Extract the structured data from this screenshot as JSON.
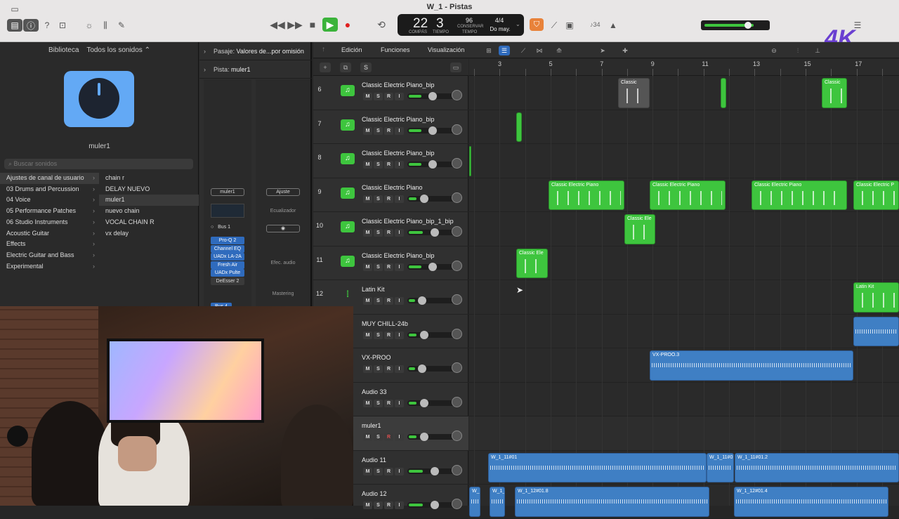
{
  "window": {
    "title": "W_1 - Pistas"
  },
  "lcd": {
    "bar": "22",
    "beat": "3",
    "bar_label": "COMPÁS",
    "beat_label": "TIEMPO",
    "tempo": "96",
    "tempo_label": "CONSERVAR",
    "tempo_sub": "TEMPO",
    "signature": "4/4",
    "key": "Do may."
  },
  "toolbar": {
    "count_in": "♪34"
  },
  "library": {
    "title": "Biblioteca",
    "filter": "Todos los sonidos ⌃",
    "patch_name": "muler1",
    "search_placeholder": "Buscar sonidos",
    "categories": [
      "Ajustes de canal de usuario",
      "03 Drums and Percussion",
      "04 Voice",
      "05 Performance Patches",
      "06 Studio Instruments",
      "Acoustic Guitar",
      "Effects",
      "Electric Guitar and Bass",
      "Experimental"
    ],
    "items": [
      "chain r",
      "DELAY NUEVO",
      "muler1",
      "nuevo chain",
      "VOCAL CHAIN R",
      "vx delay"
    ]
  },
  "inspector": {
    "region_label": "Pasaje:",
    "region_value": "Valores de...por omisión",
    "track_label": "Pista:",
    "track_value": "muler1",
    "strip1_name": "muler1",
    "bus": "Bus 1",
    "plugins": [
      "Pro-Q 2",
      "Channel EQ",
      "UADx LA-2A",
      "Fresh Air",
      "UADx Pulte",
      "DeEsser 2"
    ],
    "strip2_setting": "Ajuste",
    "strip2_eq": "Ecualizador",
    "strip2_fx": "Efec. audio",
    "strip2_name": "Mastering",
    "bus_partial": "Bus 4"
  },
  "tracks_toolbar": {
    "edit": "Edición",
    "functions": "Funciones",
    "view": "Visualización"
  },
  "ruler": {
    "bars": [
      "3",
      "5",
      "7",
      "9",
      "11",
      "13",
      "15",
      "17"
    ]
  },
  "tracks": [
    {
      "num": "6",
      "name": "Classic Electric Piano_bip",
      "icon": "piano-icon",
      "level": 0.5
    },
    {
      "num": "7",
      "name": "Classic Electric Piano_bip",
      "icon": "piano-icon",
      "level": 0.5
    },
    {
      "num": "8",
      "name": "Classic Electric Piano_bip",
      "icon": "piano-icon",
      "level": 0.5
    },
    {
      "num": "9",
      "name": "Classic Electric Piano",
      "icon": "piano-icon",
      "level": 0.3
    },
    {
      "num": "10",
      "name": "Classic Electric Piano_bip_1_bip",
      "icon": "piano-icon",
      "level": 0.55
    },
    {
      "num": "11",
      "name": "Classic Electric Piano_bip",
      "icon": "piano-icon",
      "level": 0.5
    },
    {
      "num": "12",
      "name": "Latin Kit",
      "icon": "drums-icon",
      "level": 0.25
    },
    {
      "num": "",
      "name": "MUY CHILL-24b",
      "icon": "",
      "level": 0.3
    },
    {
      "num": "",
      "name": "VX-PROO",
      "icon": "",
      "level": 0.25
    },
    {
      "num": "",
      "name": "Audio 33",
      "icon": "",
      "level": 0.3
    },
    {
      "num": "",
      "name": "muler1",
      "icon": "",
      "level": 0.3
    },
    {
      "num": "",
      "name": "Audio 11",
      "icon": "",
      "level": 0.55
    },
    {
      "num": "",
      "name": "Audio 12",
      "icon": "",
      "level": 0.55
    }
  ],
  "track_buttons": {
    "m": "M",
    "s": "S",
    "r": "R",
    "i": "I"
  },
  "regions": {
    "classic": "Classic",
    "classic_ep": "Classic Electric Piano",
    "classic_ep_p": "Classic Electric P",
    "classic_ele": "Classic Ele",
    "latin_kit": "Latin Kit",
    "vx_proo": "VX-PROO.3",
    "a11_1": "W_1_11#01",
    "a11_2": "W_1_11#0",
    "a11_3": "W_1_11#01.2",
    "a12_1": "W_1_1",
    "a12_2": "W_1_",
    "a12_3": "W_1_12#01.8",
    "a12_4": "W_1_12#01.4"
  },
  "watermark": "4K",
  "colors": {
    "accent_green": "#3ec53e",
    "accent_blue": "#3f7fc4",
    "play": "#3bb33b",
    "record": "#e02020"
  }
}
